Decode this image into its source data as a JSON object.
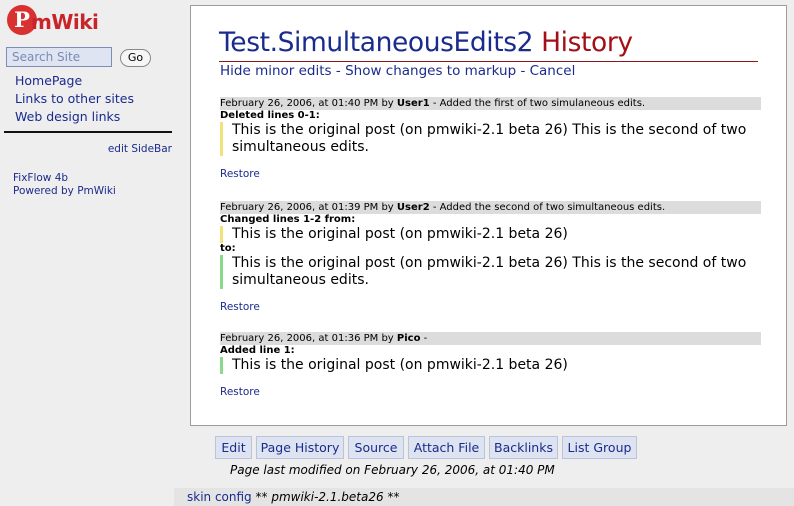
{
  "brand": {
    "logo_initial": "P",
    "logo_rest": "mWiki"
  },
  "sidebar": {
    "search_placeholder": "Search Site",
    "go_label": "Go",
    "links": [
      "HomePage",
      "Links to other sites",
      "Web design links"
    ],
    "edit_label": "edit SideBar",
    "footer": [
      "FixFlow 4b",
      "Powered by PmWiki"
    ]
  },
  "page": {
    "name": "Test.SimultaneousEdits2",
    "suffix": "History",
    "actions": [
      "Hide minor edits",
      "Show changes to markup",
      "Cancel"
    ],
    "action_separator": "-"
  },
  "history": [
    {
      "date": "February 26, 2006, at 01:40 PM",
      "by": "by",
      "user": "User1",
      "summary": "- Added the first of two simulaneous edits.",
      "label": "Deleted lines 0-1:",
      "text": "This is the original post (on pmwiki-2.1 beta 26) This is the second of two simultaneous edits.",
      "restore": "Restore"
    },
    {
      "date": "February 26, 2006, at 01:39 PM",
      "by": "by",
      "user": "User2",
      "summary": "- Added the second of two simultaneous edits.",
      "label": "Changed lines 1-2 from:",
      "from_text": "This is the original post (on pmwiki-2.1 beta 26)",
      "to_label": "to:",
      "to_text": "This is the original post (on pmwiki-2.1 beta 26) This is the second of two simultaneous edits.",
      "restore": "Restore"
    },
    {
      "date": "February 26, 2006, at 01:36 PM",
      "by": "by",
      "user": "Pico",
      "summary": "-",
      "label": "Added line 1:",
      "text": "This is the original post (on pmwiki-2.1 beta 26)",
      "restore": "Restore"
    }
  ],
  "toolbar": {
    "edit": "Edit",
    "page_history": "Page History",
    "source": "Source",
    "attach_file": "Attach File",
    "backlinks": "Backlinks",
    "list_group": "List Group"
  },
  "last_modified": "Page last modified on February 26, 2006, at 01:40 PM",
  "footer": {
    "skin_config": "skin config",
    "stars_open": "**",
    "version": "pmwiki-2.1.beta26",
    "stars_close": "**"
  }
}
